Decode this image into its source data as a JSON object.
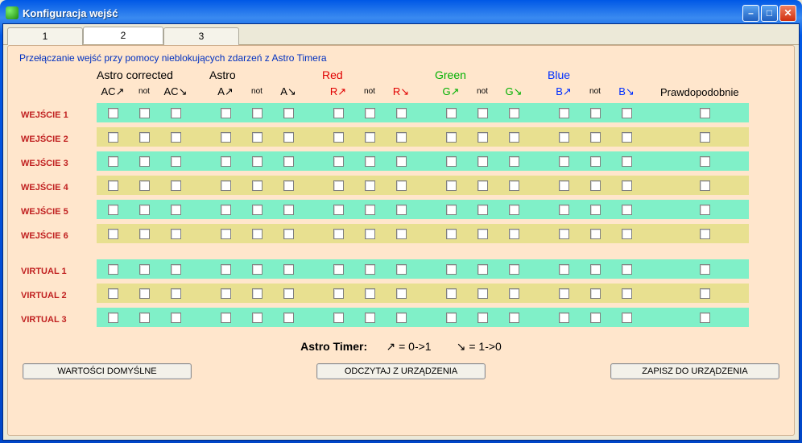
{
  "window": {
    "title": "Konfiguracja wejść"
  },
  "tabs": [
    "1",
    "2",
    "3"
  ],
  "activeTab": 1,
  "subtitle": "Przełączanie wejść przy pomocy nieblokujących zdarzeń z Astro Timera",
  "groups": [
    {
      "label": "Astro corrected",
      "colorClass": "black",
      "cols": [
        "AC",
        "AC"
      ]
    },
    {
      "label": "Astro",
      "colorClass": "black",
      "cols": [
        "A",
        "A"
      ]
    },
    {
      "label": "Red",
      "colorClass": "red",
      "cols": [
        "R",
        "R"
      ]
    },
    {
      "label": "Green",
      "colorClass": "green",
      "cols": [
        "G",
        "G"
      ]
    },
    {
      "label": "Blue",
      "colorClass": "blue",
      "cols": [
        "B",
        "B"
      ]
    }
  ],
  "notLabel": "not",
  "lastColLabel": "Prawdopodobnie",
  "rows": [
    "WEJŚCIE 1",
    "WEJŚCIE 2",
    "WEJŚCIE 3",
    "WEJŚCIE 4",
    "WEJŚCIE 5",
    "WEJŚCIE 6"
  ],
  "rows2": [
    "VIRTUAL 1",
    "VIRTUAL 2",
    "VIRTUAL 3"
  ],
  "legend": {
    "title": "Astro Timer:",
    "up": "↗ = 0->1",
    "down": "↘ = 1->0"
  },
  "buttons": {
    "defaults": "WARTOŚCI DOMYŚLNE",
    "read": "ODCZYTAJ Z URZĄDZENIA",
    "write": "ZAPISZ DO URZĄDZENIA"
  },
  "arrows": {
    "up": "↗",
    "down": "↘"
  }
}
